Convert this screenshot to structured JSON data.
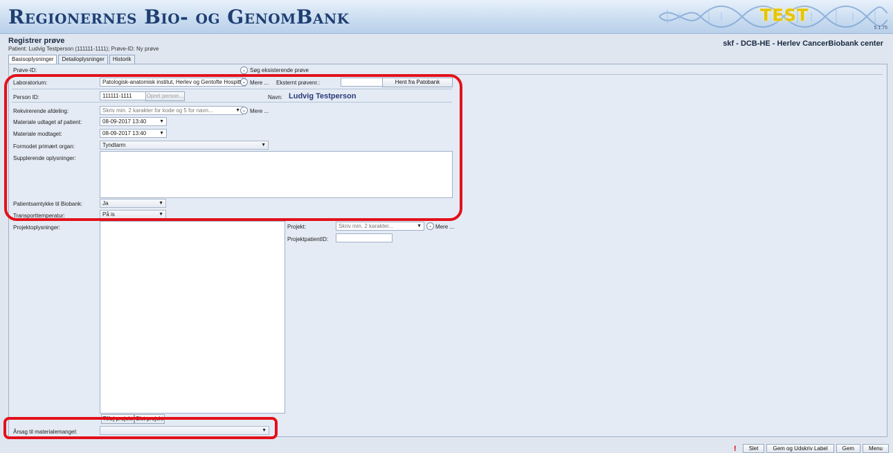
{
  "banner": {
    "title": "Regionernes Bio- og GenomBank",
    "test_label": "TEST",
    "version": "5.1.75"
  },
  "header": {
    "page_title": "Registrer prøve",
    "patient_line": "Patient: Ludvig Testperson (111111-1111); Prøve-ID: Ny prøve",
    "site": "skf - DCB-HE - Herlev CancerBiobank center"
  },
  "tabs": [
    "Basisoplysninger",
    "Detailoplysninger",
    "Historik"
  ],
  "form": {
    "prove_id_label": "Prøve-ID:",
    "search_existing": "Søg eksisterende prøve",
    "laboratorium_label": "Laboratorium:",
    "laboratorium_value": "Patologisk-anatomisk institut, Herlev og Gentofte Hospital",
    "mere": "Mere ...",
    "eksternt_label": "Eksternt prøvenr.:",
    "hent_button": "Hent fra Patobank",
    "person_id_label": "Person ID:",
    "person_id_value": "111111-1111",
    "opret_button": "Opret person...",
    "navn_label": "Navn:",
    "navn_value": "Ludvig Testperson",
    "rekvirerende_label": "Rekvirerende afdeling:",
    "rekvirerende_placeholder": "Skriv min. 2 karakter for kode og 5 for navn...",
    "udtaget_label": "Materiale udtaget af patient:",
    "udtaget_value": "08-09-2017 13:40",
    "modtaget_label": "Materiale modtaget:",
    "modtaget_value": "08-09-2017 13:40",
    "organ_label": "Formodet primært organ:",
    "organ_value": "Tyndtarm",
    "supplerende_label": "Supplerende oplysninger:",
    "samtykke_label": "Patientsamtykke til Biobank:",
    "samtykke_value": "Ja",
    "transport_label": "Transporttemperatur:",
    "transport_value": "På is",
    "projekt_oplysninger_label": "Projektoplysninger:",
    "projekt_label": "Projekt:",
    "projekt_placeholder": "Skriv min. 2 karakter...",
    "projekt_patient_label": "ProjektpatientID:",
    "tilfoej_button": "Tilføj projekt",
    "slet_projekt_button": "Slet projekt",
    "aarsag_label": "Årsag til materialemangel:",
    "aarsag_value": ""
  },
  "bottom_bar": {
    "warning": "!",
    "slet": "Slet",
    "gem_udskriv": "Gem og Udskriv Label",
    "gem": "Gem",
    "menu": "Menu"
  },
  "colors": {
    "highlight": "#e3101a",
    "brand": "#1f3f72",
    "test": "#e8c400"
  },
  "icons": {
    "dropdown": "▼",
    "expand_circle": "⌄"
  }
}
